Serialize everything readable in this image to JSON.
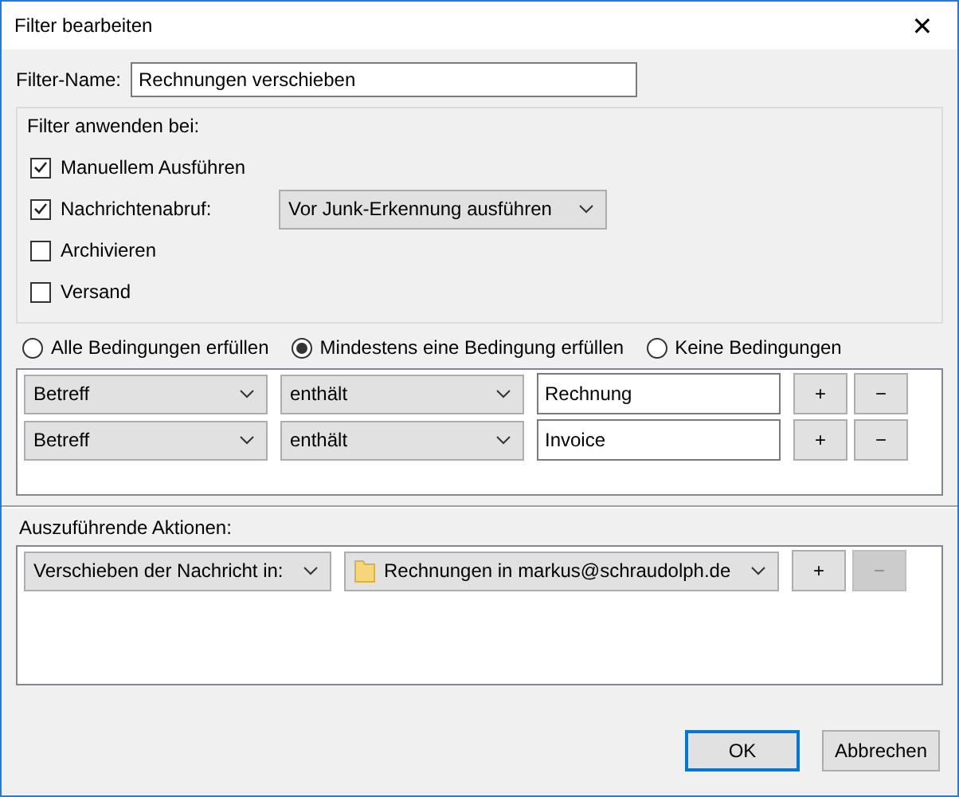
{
  "window": {
    "title": "Filter bearbeiten",
    "close": "✕"
  },
  "filter_name": {
    "label": "Filter-Name:",
    "value": "Rechnungen verschieben"
  },
  "apply_group": {
    "title": "Filter anwenden bei:",
    "options": [
      {
        "label": "Manuellem Ausführen",
        "checked": true
      },
      {
        "label": "Nachrichtenabruf:",
        "checked": true,
        "dropdown": "Vor Junk-Erkennung ausführen"
      },
      {
        "label": "Archivieren",
        "checked": false
      },
      {
        "label": "Versand",
        "checked": false
      }
    ]
  },
  "match_mode": [
    {
      "label": "Alle Bedingungen erfüllen",
      "selected": false
    },
    {
      "label": "Mindestens eine Bedingung erfüllen",
      "selected": true
    },
    {
      "label": "Keine Bedingungen",
      "selected": false
    }
  ],
  "conditions": [
    {
      "field": "Betreff",
      "operator": "enthält",
      "value": "Rechnung",
      "add": "+",
      "remove": "−",
      "remove_disabled": false
    },
    {
      "field": "Betreff",
      "operator": "enthält",
      "value": "Invoice",
      "add": "+",
      "remove": "−",
      "remove_disabled": false
    }
  ],
  "actions": {
    "title": "Auszuführende Aktionen:",
    "rows": [
      {
        "action": "Verschieben der Nachricht in:",
        "target": "Rechnungen in markus@schraudolph.de",
        "add": "+",
        "remove": "−",
        "remove_disabled": true
      }
    ]
  },
  "buttons": [
    {
      "label": "OK",
      "default": true
    },
    {
      "label": "Abbrechen",
      "default": false
    }
  ]
}
